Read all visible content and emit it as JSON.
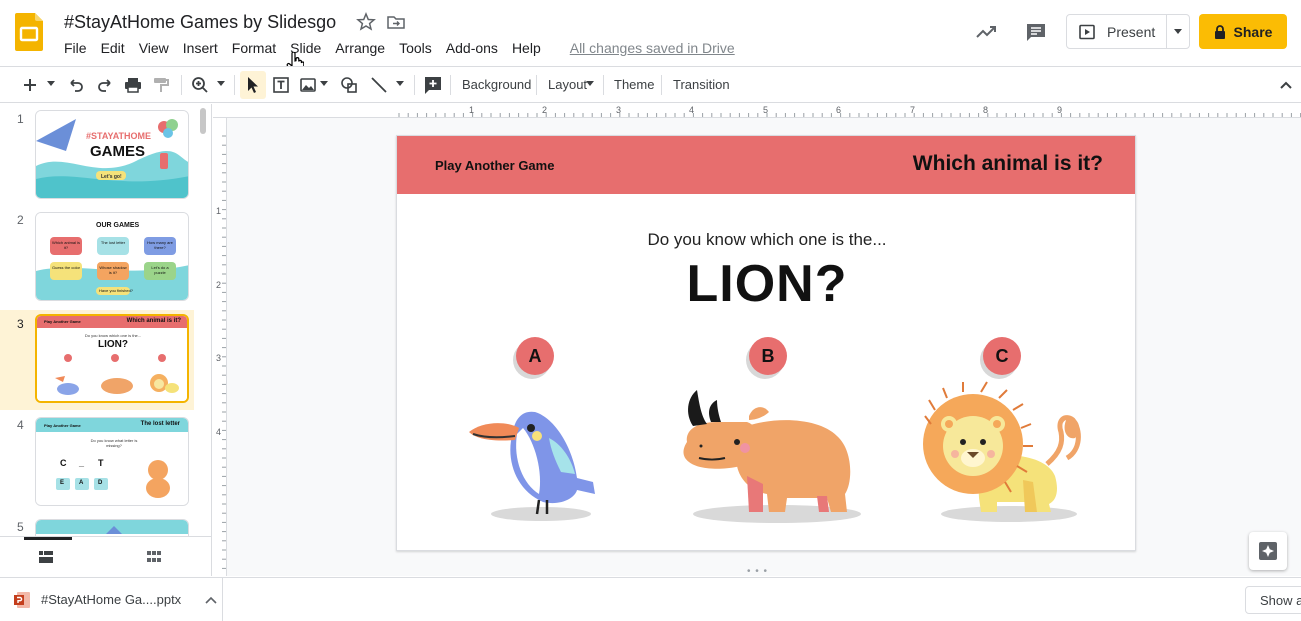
{
  "document": {
    "title": "#StayAtHome Games by Slidesgo",
    "saved_status": "All changes saved in Drive"
  },
  "menu": [
    "File",
    "Edit",
    "View",
    "Insert",
    "Format",
    "Slide",
    "Arrange",
    "Tools",
    "Add-ons",
    "Help"
  ],
  "header_actions": {
    "present_label": "Present",
    "share_label": "Share"
  },
  "toolbar": {
    "background_label": "Background",
    "layout_label": "Layout",
    "theme_label": "Theme",
    "transition_label": "Transition"
  },
  "ruler": {
    "horizontal": [
      "1",
      "2",
      "3",
      "4",
      "5",
      "6",
      "7",
      "8",
      "9"
    ],
    "vertical": [
      "1",
      "2",
      "3",
      "4"
    ]
  },
  "filmstrip": {
    "slides": [
      {
        "number": "1",
        "title": "#STAYATHOME",
        "subtitle": "GAMES",
        "button": "Let's go!"
      },
      {
        "number": "2",
        "title": "OUR GAMES",
        "items": [
          "Which animal is it?",
          "The lost letter",
          "How many are there?",
          "Guess the color",
          "Whose shadow is it?",
          "Let's do a puzzle"
        ],
        "footer": "Have you finished?"
      },
      {
        "number": "3",
        "left": "Play Another Game",
        "right": "Which animal is it?",
        "question": "Do you know which one is the...",
        "animal": "LION?",
        "selected": true
      },
      {
        "number": "4",
        "left": "Play Another Game",
        "right": "The lost letter",
        "question": "Do you know what letter is missing?",
        "word": [
          "C",
          "_",
          "T"
        ],
        "options": [
          "E",
          "A",
          "D"
        ]
      },
      {
        "number": "5"
      }
    ]
  },
  "slide": {
    "play_another": "Play Another Game",
    "heading": "Which animal is it?",
    "question": "Do you know which one is the...",
    "answer_animal": "LION?",
    "options": [
      "A",
      "B",
      "C"
    ],
    "accent_color": "#e76e6e"
  },
  "download": {
    "filename": "#StayAtHome Ga....pptx",
    "show_all": "Show a"
  },
  "colors": {
    "share_button": "#fbbc04",
    "slides_brand": "#f4b400",
    "banner": "#e76e6e"
  }
}
